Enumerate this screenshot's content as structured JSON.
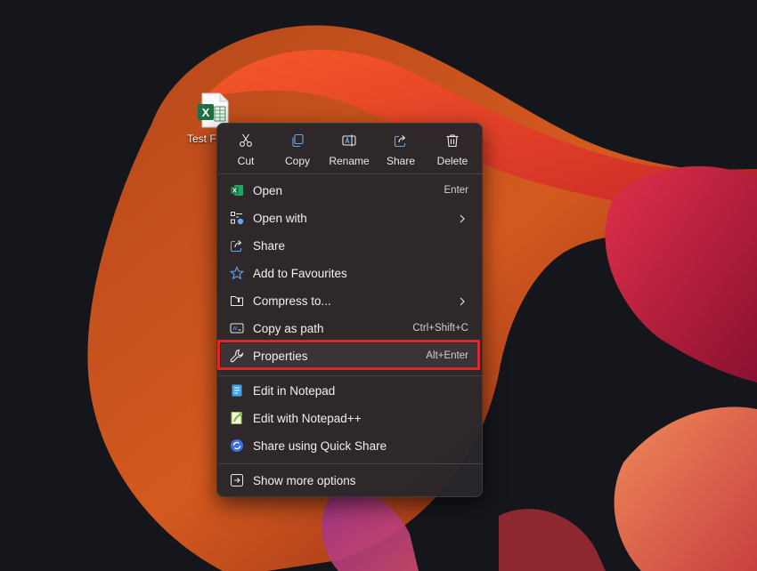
{
  "desktop": {
    "file_label": "Test Fi",
    "file_icon": "excel-file-icon"
  },
  "context_menu": {
    "toolbar": [
      {
        "label": "Cut",
        "icon": "scissors-icon"
      },
      {
        "label": "Copy",
        "icon": "copy-icon"
      },
      {
        "label": "Rename",
        "icon": "rename-icon"
      },
      {
        "label": "Share",
        "icon": "share-icon"
      },
      {
        "label": "Delete",
        "icon": "trash-icon"
      }
    ],
    "items": [
      {
        "label": "Open",
        "shortcut": "Enter",
        "icon": "excel-icon"
      },
      {
        "label": "Open with",
        "shortcut": "",
        "icon": "open-with-icon",
        "submenu": true
      },
      {
        "label": "Share",
        "shortcut": "",
        "icon": "share-icon"
      },
      {
        "label": "Add to Favourites",
        "shortcut": "",
        "icon": "star-icon"
      },
      {
        "label": "Compress to...",
        "shortcut": "",
        "icon": "zip-folder-icon",
        "submenu": true
      },
      {
        "label": "Copy as path",
        "shortcut": "Ctrl+Shift+C",
        "icon": "path-icon"
      },
      {
        "label": "Properties",
        "shortcut": "Alt+Enter",
        "icon": "wrench-icon",
        "highlighted": true
      },
      {
        "label": "Edit in Notepad",
        "shortcut": "",
        "icon": "notepad-icon"
      },
      {
        "label": "Edit with Notepad++",
        "shortcut": "",
        "icon": "notepad-plus-plus-icon"
      },
      {
        "label": "Share using Quick Share",
        "shortcut": "",
        "icon": "quick-share-icon"
      },
      {
        "label": "Show more options",
        "shortcut": "",
        "icon": "more-options-icon"
      }
    ]
  },
  "colors": {
    "highlight_border": "#d82a2a",
    "accent_blue": "#5fa8f0",
    "excel_green": "#1e7145"
  }
}
